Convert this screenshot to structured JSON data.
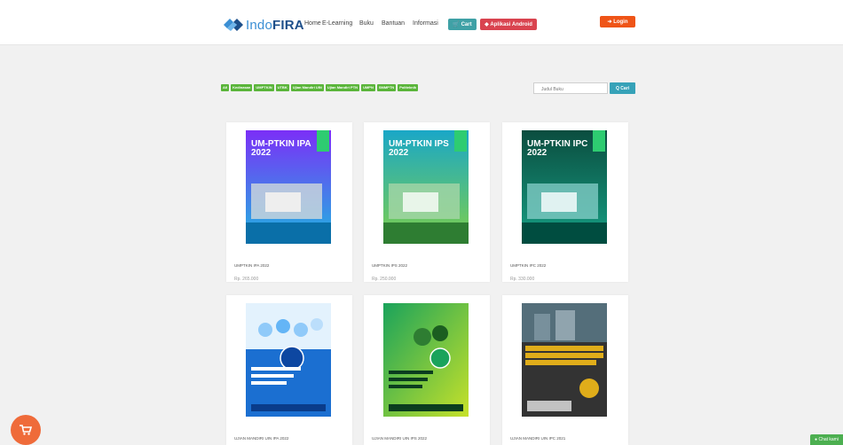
{
  "brand": {
    "prefix": "Indo",
    "suffix": "FIRA"
  },
  "nav": {
    "home": "Home",
    "elearning": "E-Learning",
    "buku": "Buku",
    "bantuan": "Bantuan",
    "informasi": "Informasi"
  },
  "buttons": {
    "cart": "Cart",
    "android": "Aplikasi Android",
    "login": "Login"
  },
  "filters": [
    "All",
    "Kedinasan",
    "UMPTKIN",
    "UTBK",
    "Ujian Mandiri UIN",
    "Ujian Mandiri PTN",
    "UMPN",
    "SMMPTN",
    "Politeknik"
  ],
  "search": {
    "placeholder": "Judul Buku",
    "button": "Q Cari"
  },
  "products": [
    {
      "title": "UMPTKIN IPA 2022",
      "price": "Rp. 265.000",
      "cover_title": "UM-PTKIN IPA 2022",
      "cover_colors": [
        "#7b2ff7",
        "#1fb7e0"
      ]
    },
    {
      "title": "UMPTKIN IPS 2022",
      "price": "Rp. 250.000",
      "cover_title": "UM-PTKIN IPS 2022",
      "cover_colors": [
        "#1aa7c7",
        "#7fd04a"
      ]
    },
    {
      "title": "UMPTKIN IPC 2022",
      "price": "Rp. 330.000",
      "cover_title": "UM-PTKIN IPC 2022",
      "cover_colors": [
        "#0b4d3f",
        "#16a085"
      ]
    },
    {
      "title": "UJIAN MANDIRI UIN IPA 2022",
      "price": "",
      "cover_title": "",
      "cover_colors": [
        "#1b6fd1",
        "#0a3c8a"
      ]
    },
    {
      "title": "UJIAN MANDIRI UIN IPS 2022",
      "price": "",
      "cover_title": "",
      "cover_colors": [
        "#1aa35b",
        "#c6e12a"
      ]
    },
    {
      "title": "UJIAN MANDIRI UIN IPC 2021",
      "price": "",
      "cover_title": "",
      "cover_colors": [
        "#333333",
        "#e0ad1a"
      ]
    }
  ],
  "widgets": {
    "chat": "Chat kami"
  }
}
